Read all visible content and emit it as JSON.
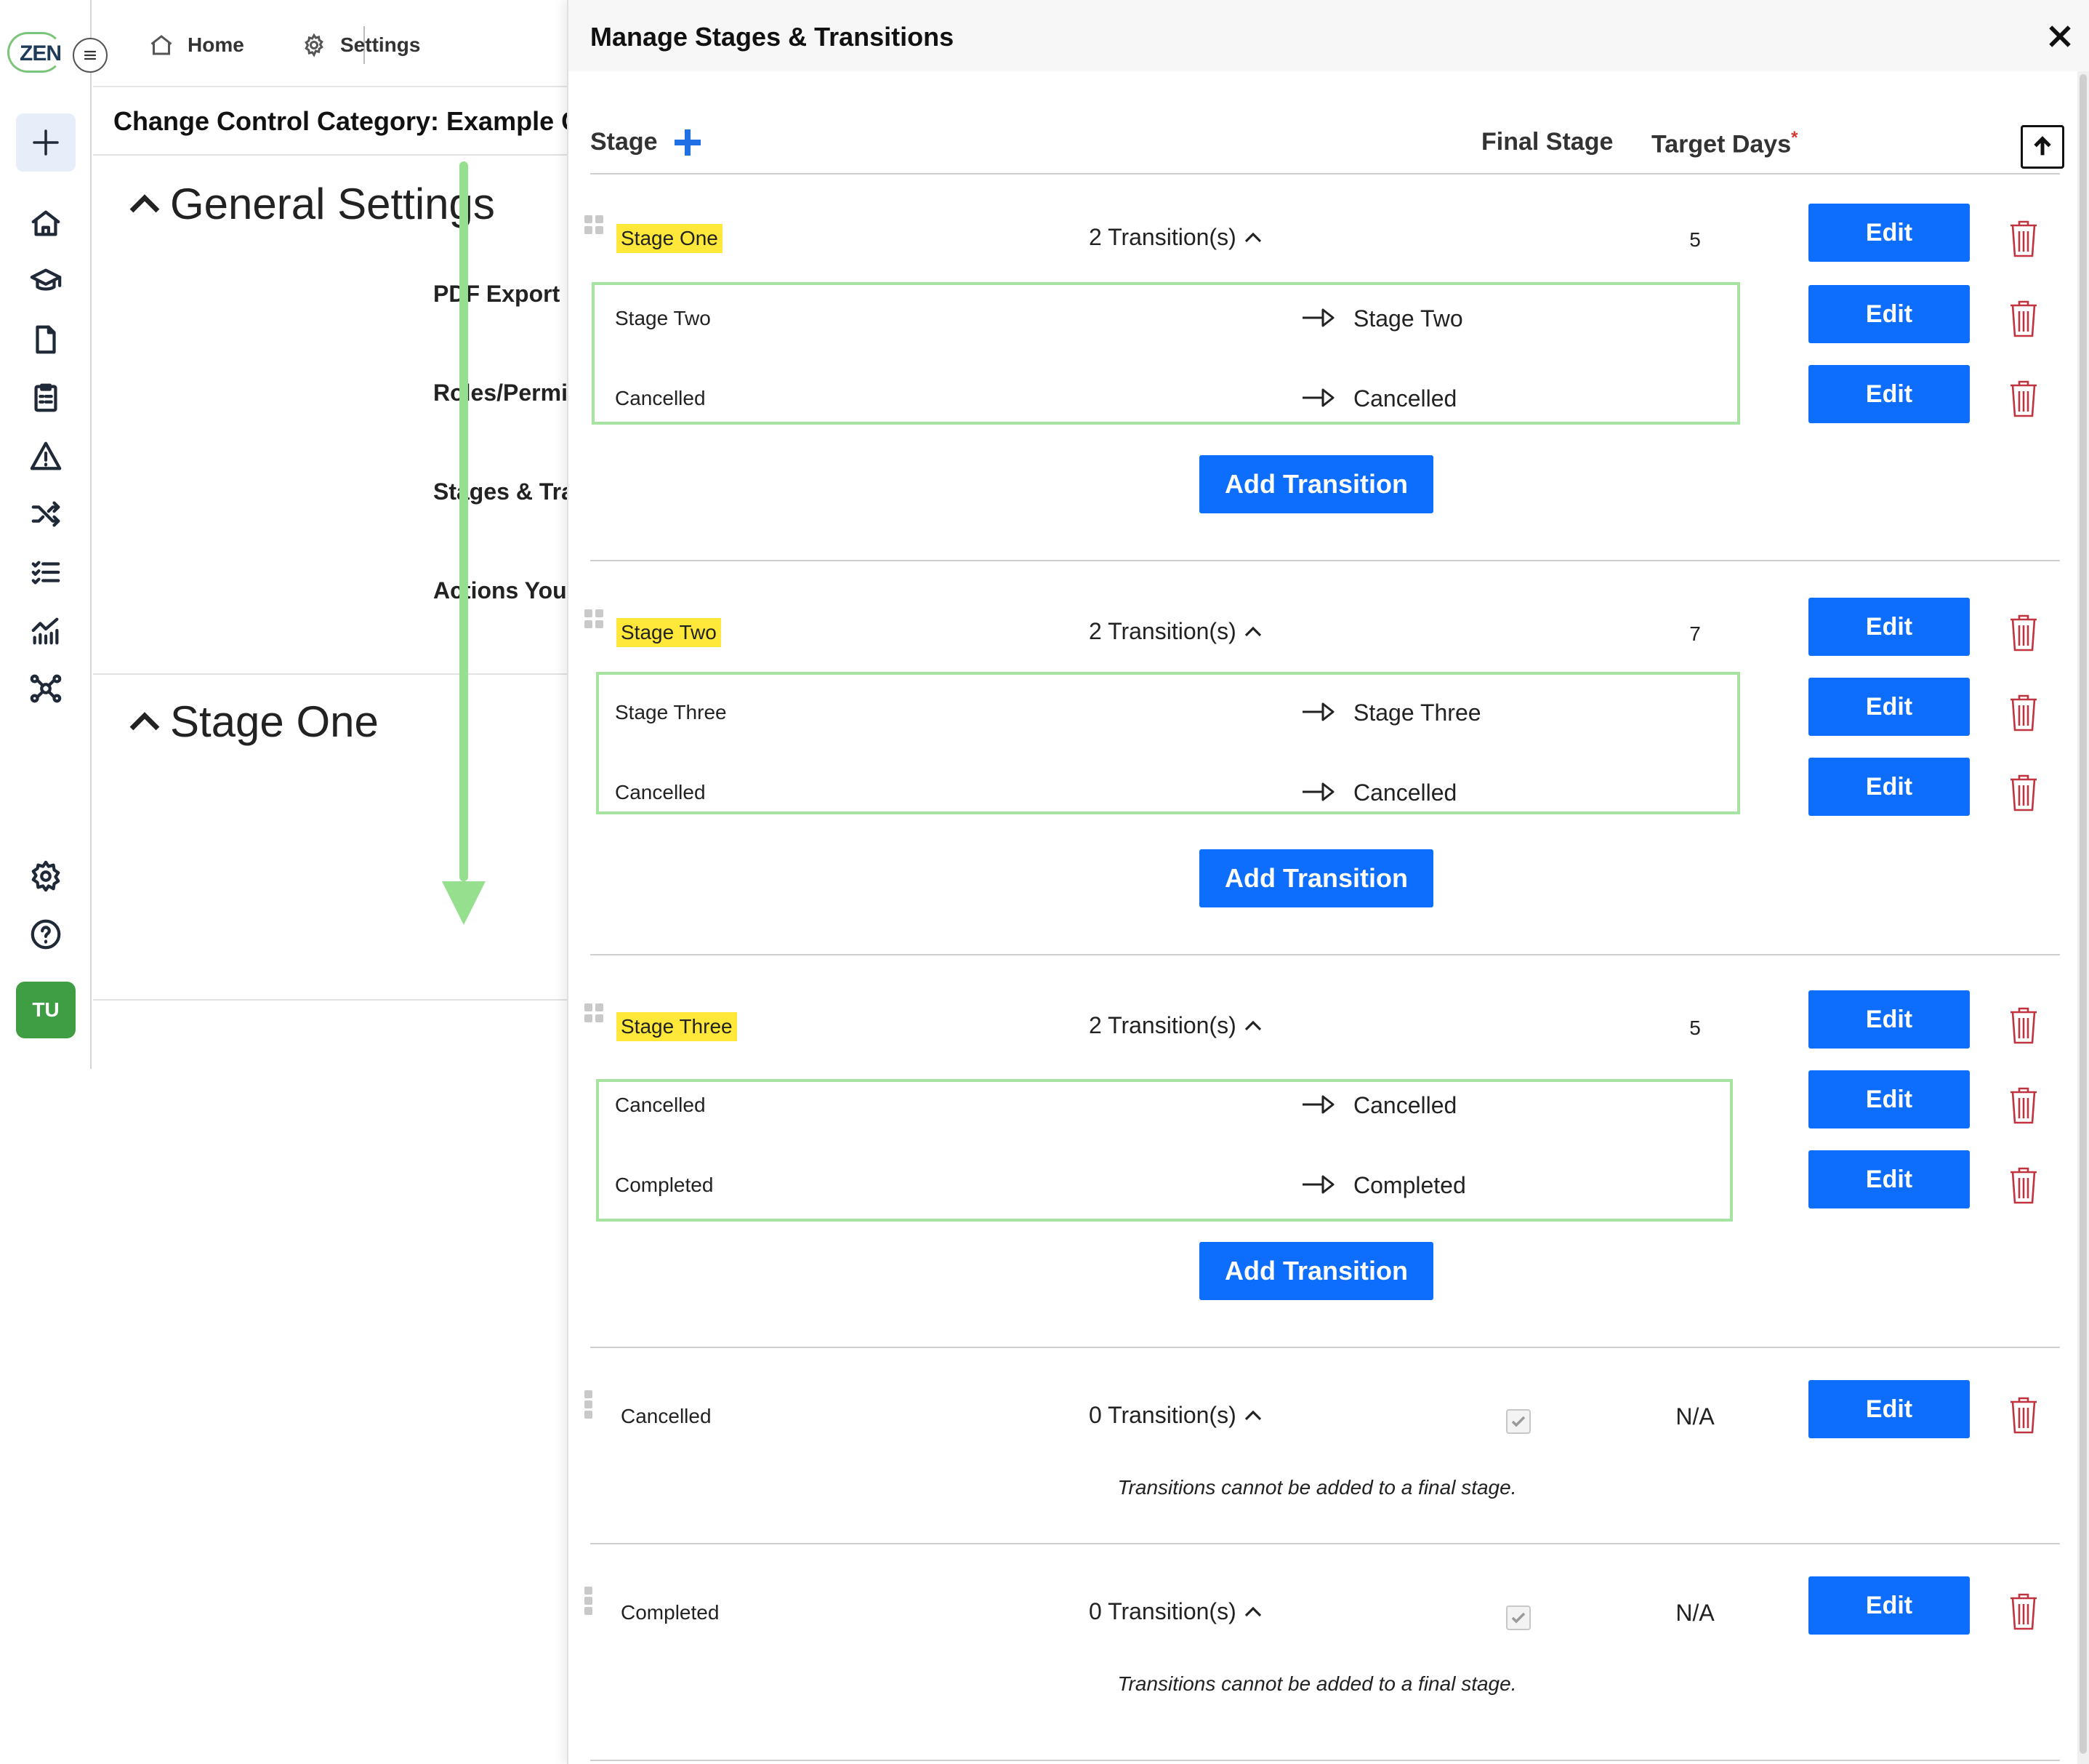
{
  "app": {
    "logo_text": "ZEN",
    "user_initials": "TU"
  },
  "nav": {
    "menu_icon": "hamburger-icon",
    "add_icon": "plus-icon",
    "items": [
      {
        "icon": "home-icon"
      },
      {
        "icon": "graduation-cap-icon"
      },
      {
        "icon": "document-icon"
      },
      {
        "icon": "clipboard-icon"
      },
      {
        "icon": "warning-icon"
      },
      {
        "icon": "shuffle-icon"
      },
      {
        "icon": "checklist-icon"
      },
      {
        "icon": "chart-icon"
      },
      {
        "icon": "network-icon"
      },
      {
        "icon": "settings-gear-icon"
      },
      {
        "icon": "help-icon"
      }
    ]
  },
  "breadcrumb": {
    "home": "Home",
    "settings": "Settings"
  },
  "page": {
    "title": "Change Control Category: Example Cha",
    "general_settings": "General Settings",
    "links": [
      "PDF Export (",
      "Roles/Permi",
      "Stages & Tra",
      "Actions You"
    ],
    "stage_section": "Stage One"
  },
  "modal": {
    "title": "Manage Stages & Transitions",
    "columns": {
      "stage": "Stage",
      "final_stage": "Final Stage",
      "target_days": "Target Days",
      "required_mark": "*"
    },
    "edit_label": "Edit",
    "add_transition_label": "Add Transition",
    "final_stage_note": "Transitions cannot be added to a final stage.",
    "stages": [
      {
        "name": "Stage One",
        "transitions_label": "2 Transition(s)",
        "target_days": "5",
        "is_final": false,
        "transitions": [
          {
            "from": "Stage Two",
            "to": "Stage Two"
          },
          {
            "from": "Cancelled",
            "to": "Cancelled"
          }
        ]
      },
      {
        "name": "Stage Two",
        "transitions_label": "2 Transition(s)",
        "target_days": "7",
        "is_final": false,
        "transitions": [
          {
            "from": "Stage Three",
            "to": "Stage Three"
          },
          {
            "from": "Cancelled",
            "to": "Cancelled"
          }
        ]
      },
      {
        "name": "Stage Three",
        "transitions_label": "2 Transition(s)",
        "target_days": "5",
        "is_final": false,
        "transitions": [
          {
            "from": "Cancelled",
            "to": "Cancelled"
          },
          {
            "from": "Completed",
            "to": "Completed"
          }
        ]
      },
      {
        "name": "Cancelled",
        "transitions_label": "0 Transition(s)",
        "target_days": "N/A",
        "is_final": true,
        "transitions": []
      },
      {
        "name": "Completed",
        "transitions_label": "0 Transition(s)",
        "target_days": "N/A",
        "is_final": true,
        "transitions": []
      }
    ]
  },
  "colors": {
    "primary_button": "#0d6efd",
    "stage_highlight": "#ffe83a",
    "transition_border": "#a6e3a1",
    "delete_icon": "#c0343f",
    "scroll_arrow": "#96df8f",
    "avatar": "#3f9e44"
  }
}
